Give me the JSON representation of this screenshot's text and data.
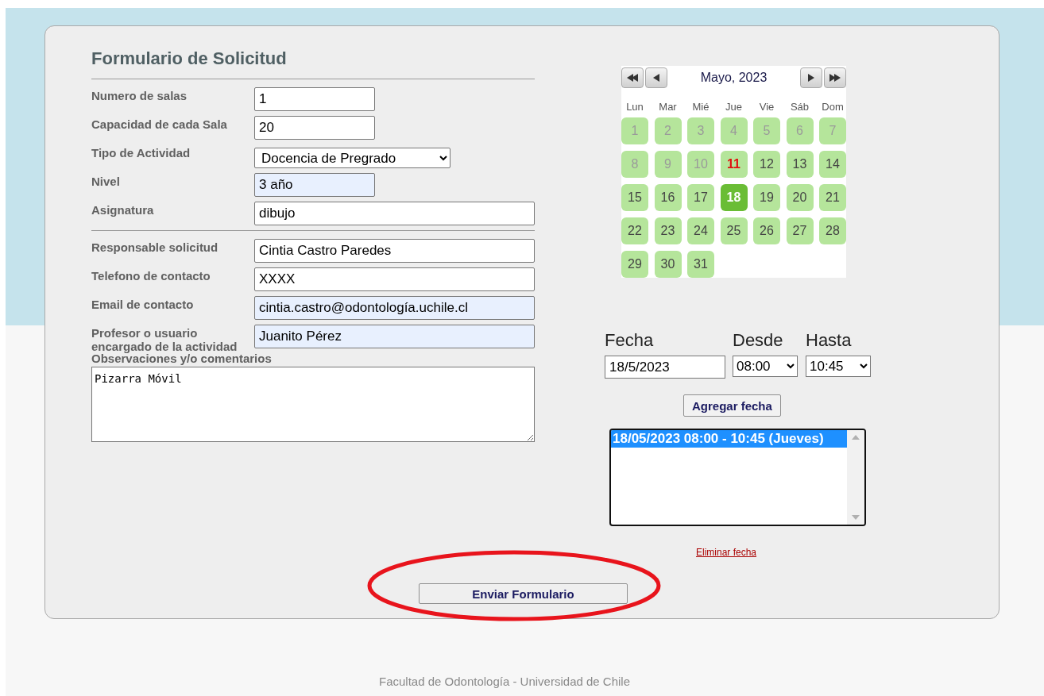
{
  "form": {
    "title": "Formulario de Solicitud",
    "sections": [
      {
        "fields": [
          {
            "label": "Numero de salas",
            "kind": "text",
            "value": "1",
            "wide": false,
            "autofilled": false
          },
          {
            "label": "Capacidad de cada Sala",
            "kind": "text",
            "value": "20",
            "wide": false,
            "autofilled": false
          },
          {
            "label": "Tipo de Actividad",
            "kind": "select",
            "value": "Docencia de Pregrado",
            "wide": false,
            "autofilled": false
          },
          {
            "label": "Nivel",
            "kind": "text",
            "value": "3 año",
            "wide": false,
            "autofilled": true
          },
          {
            "label": "Asignatura",
            "kind": "text",
            "value": "dibujo",
            "wide": true,
            "autofilled": false
          }
        ]
      },
      {
        "fields": [
          {
            "label": "Responsable solicitud",
            "kind": "text",
            "value": "Cintia Castro Paredes",
            "wide": true,
            "autofilled": false
          },
          {
            "label": "Telefono de contacto",
            "kind": "text",
            "value": "XXXX",
            "wide": true,
            "autofilled": false
          },
          {
            "label": "Email de contacto",
            "kind": "text",
            "value": "cintia.castro@odontología.uchile.cl",
            "wide": true,
            "autofilled": true
          },
          {
            "label": "Profesor o usuario encargado de la actividad",
            "kind": "text",
            "value": "Juanito Pérez",
            "wide": true,
            "autofilled": true
          }
        ]
      }
    ],
    "comments": {
      "label": "Observaciones y/o comentarios",
      "value": "Pizarra Móvil"
    },
    "submit": "Enviar Formulario"
  },
  "calendar": {
    "month": "Mayo, 2023",
    "weekdays": [
      "Lun",
      "Mar",
      "Mié",
      "Jue",
      "Vie",
      "Sáb",
      "Dom"
    ],
    "days": [
      {
        "label": "1",
        "disabled": true,
        "today": false,
        "selected": false
      },
      {
        "label": "2",
        "disabled": true,
        "today": false,
        "selected": false
      },
      {
        "label": "3",
        "disabled": true,
        "today": false,
        "selected": false
      },
      {
        "label": "4",
        "disabled": true,
        "today": false,
        "selected": false
      },
      {
        "label": "5",
        "disabled": true,
        "today": false,
        "selected": false
      },
      {
        "label": "6",
        "disabled": true,
        "today": false,
        "selected": false
      },
      {
        "label": "7",
        "disabled": true,
        "today": false,
        "selected": false
      },
      {
        "label": "8",
        "disabled": true,
        "today": false,
        "selected": false
      },
      {
        "label": "9",
        "disabled": true,
        "today": false,
        "selected": false
      },
      {
        "label": "10",
        "disabled": true,
        "today": false,
        "selected": false
      },
      {
        "label": "11",
        "disabled": false,
        "today": true,
        "selected": false
      },
      {
        "label": "12",
        "disabled": false,
        "today": false,
        "selected": false
      },
      {
        "label": "13",
        "disabled": false,
        "today": false,
        "selected": false
      },
      {
        "label": "14",
        "disabled": false,
        "today": false,
        "selected": false
      },
      {
        "label": "15",
        "disabled": false,
        "today": false,
        "selected": false
      },
      {
        "label": "16",
        "disabled": false,
        "today": false,
        "selected": false
      },
      {
        "label": "17",
        "disabled": false,
        "today": false,
        "selected": false
      },
      {
        "label": "18",
        "disabled": false,
        "today": false,
        "selected": true
      },
      {
        "label": "19",
        "disabled": false,
        "today": false,
        "selected": false
      },
      {
        "label": "20",
        "disabled": false,
        "today": false,
        "selected": false
      },
      {
        "label": "21",
        "disabled": false,
        "today": false,
        "selected": false
      },
      {
        "label": "22",
        "disabled": false,
        "today": false,
        "selected": false
      },
      {
        "label": "23",
        "disabled": false,
        "today": false,
        "selected": false
      },
      {
        "label": "24",
        "disabled": false,
        "today": false,
        "selected": false
      },
      {
        "label": "25",
        "disabled": false,
        "today": false,
        "selected": false
      },
      {
        "label": "26",
        "disabled": false,
        "today": false,
        "selected": false
      },
      {
        "label": "27",
        "disabled": false,
        "today": false,
        "selected": false
      },
      {
        "label": "28",
        "disabled": false,
        "today": false,
        "selected": false
      },
      {
        "label": "29",
        "disabled": false,
        "today": false,
        "selected": false
      },
      {
        "label": "30",
        "disabled": false,
        "today": false,
        "selected": false
      },
      {
        "label": "31",
        "disabled": false,
        "today": false,
        "selected": false
      }
    ]
  },
  "schedule": {
    "date_label": "Fecha",
    "from_label": "Desde",
    "to_label": "Hasta",
    "date": "18/5/2023",
    "from": "08:00",
    "to": "10:45",
    "add_button": "Agregar fecha",
    "entries": [
      {
        "label": "18/05/2023 08:00 - 10:45 (Jueves)",
        "selected": true
      }
    ],
    "remove_link": "Eliminar fecha"
  },
  "footer": "Facultad de Odontología - Universidad de Chile"
}
